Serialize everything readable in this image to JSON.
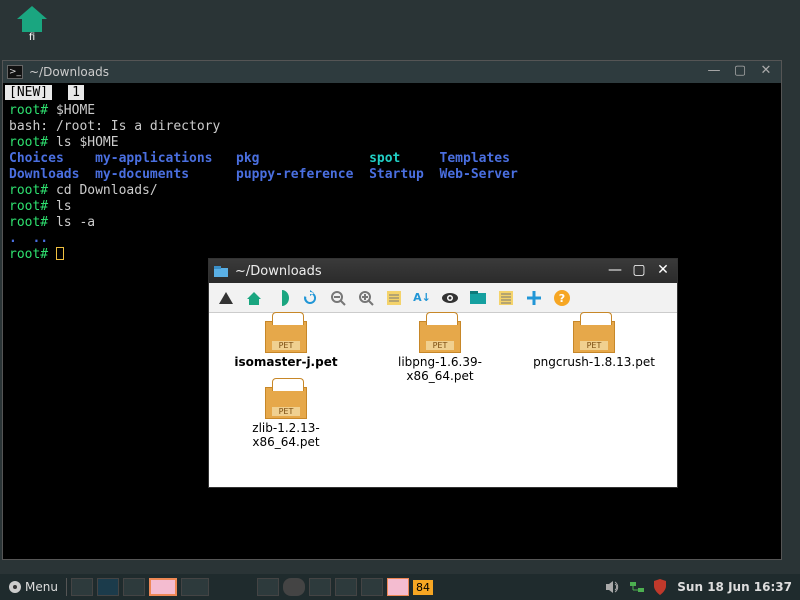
{
  "desktop": {
    "icon_label": "fi"
  },
  "terminal": {
    "title": "~/Downloads",
    "tab_new": "[NEW]",
    "tab_label": "1",
    "prompt": "root#",
    "lines": {
      "l1_cmd": "$HOME",
      "l2": "bash: /root: Is a directory",
      "l3_cmd": "ls $HOME",
      "ls_row1": [
        "Choices",
        "my-applications",
        "pkg",
        "spot",
        "Templates"
      ],
      "ls_row2": [
        "Downloads",
        "my-documents",
        "puppy-reference",
        "Startup",
        "Web-Server"
      ],
      "l4_cmd": "cd Downloads/",
      "l5_cmd": "ls",
      "l6_cmd": "ls -a",
      "dots": ".  .."
    }
  },
  "fm": {
    "title": "~/Downloads",
    "files": [
      {
        "name": "isomaster-j.pet",
        "bold": true
      },
      {
        "name": "libpng-1.6.39-x86_64.pet",
        "bold": false
      },
      {
        "name": "pngcrush-1.8.13.pet",
        "bold": false
      },
      {
        "name": "zlib-1.2.13-x86_64.pet",
        "bold": false
      }
    ]
  },
  "taskbar": {
    "menu": "Menu",
    "temp": "84",
    "clock": "Sun 18 Jun 16:37"
  }
}
